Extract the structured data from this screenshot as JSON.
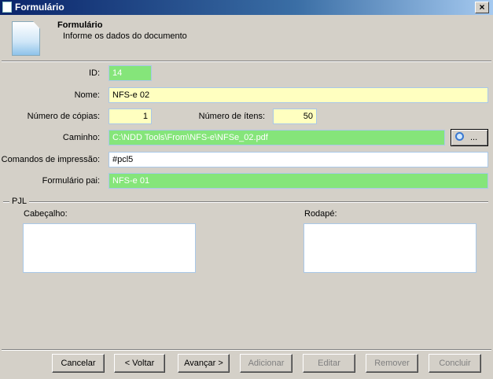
{
  "window": {
    "title": "Formulário",
    "close": "×"
  },
  "header": {
    "title": "Formulário",
    "subtitle": "Informe os dados do documento"
  },
  "fields": {
    "id": {
      "label": "ID:",
      "value": "14"
    },
    "nome": {
      "label": "Nome:",
      "value": "NFS-e 02"
    },
    "copias": {
      "label": "Número de cópias:",
      "value": "1"
    },
    "itens": {
      "label": "Número de ítens:",
      "value": "50"
    },
    "caminho": {
      "label": "Caminho:",
      "value": "C:\\NDD Tools\\From\\NFS-e\\NFSe_02.pdf",
      "browse": "..."
    },
    "comandos": {
      "label": "Comandos de impressão:",
      "value": "#pcl5"
    },
    "pai": {
      "label": "Formulário pai:",
      "value": "NFS-e 01"
    }
  },
  "pjl": {
    "legend": "PJL",
    "header_label": "Cabeçalho:",
    "footer_label": "Rodapé:"
  },
  "buttons": {
    "cancel": "Cancelar",
    "back": "< Voltar",
    "next": "Avançar >",
    "add": "Adicionar",
    "edit": "Editar",
    "remove": "Remover",
    "finish": "Concluir"
  }
}
